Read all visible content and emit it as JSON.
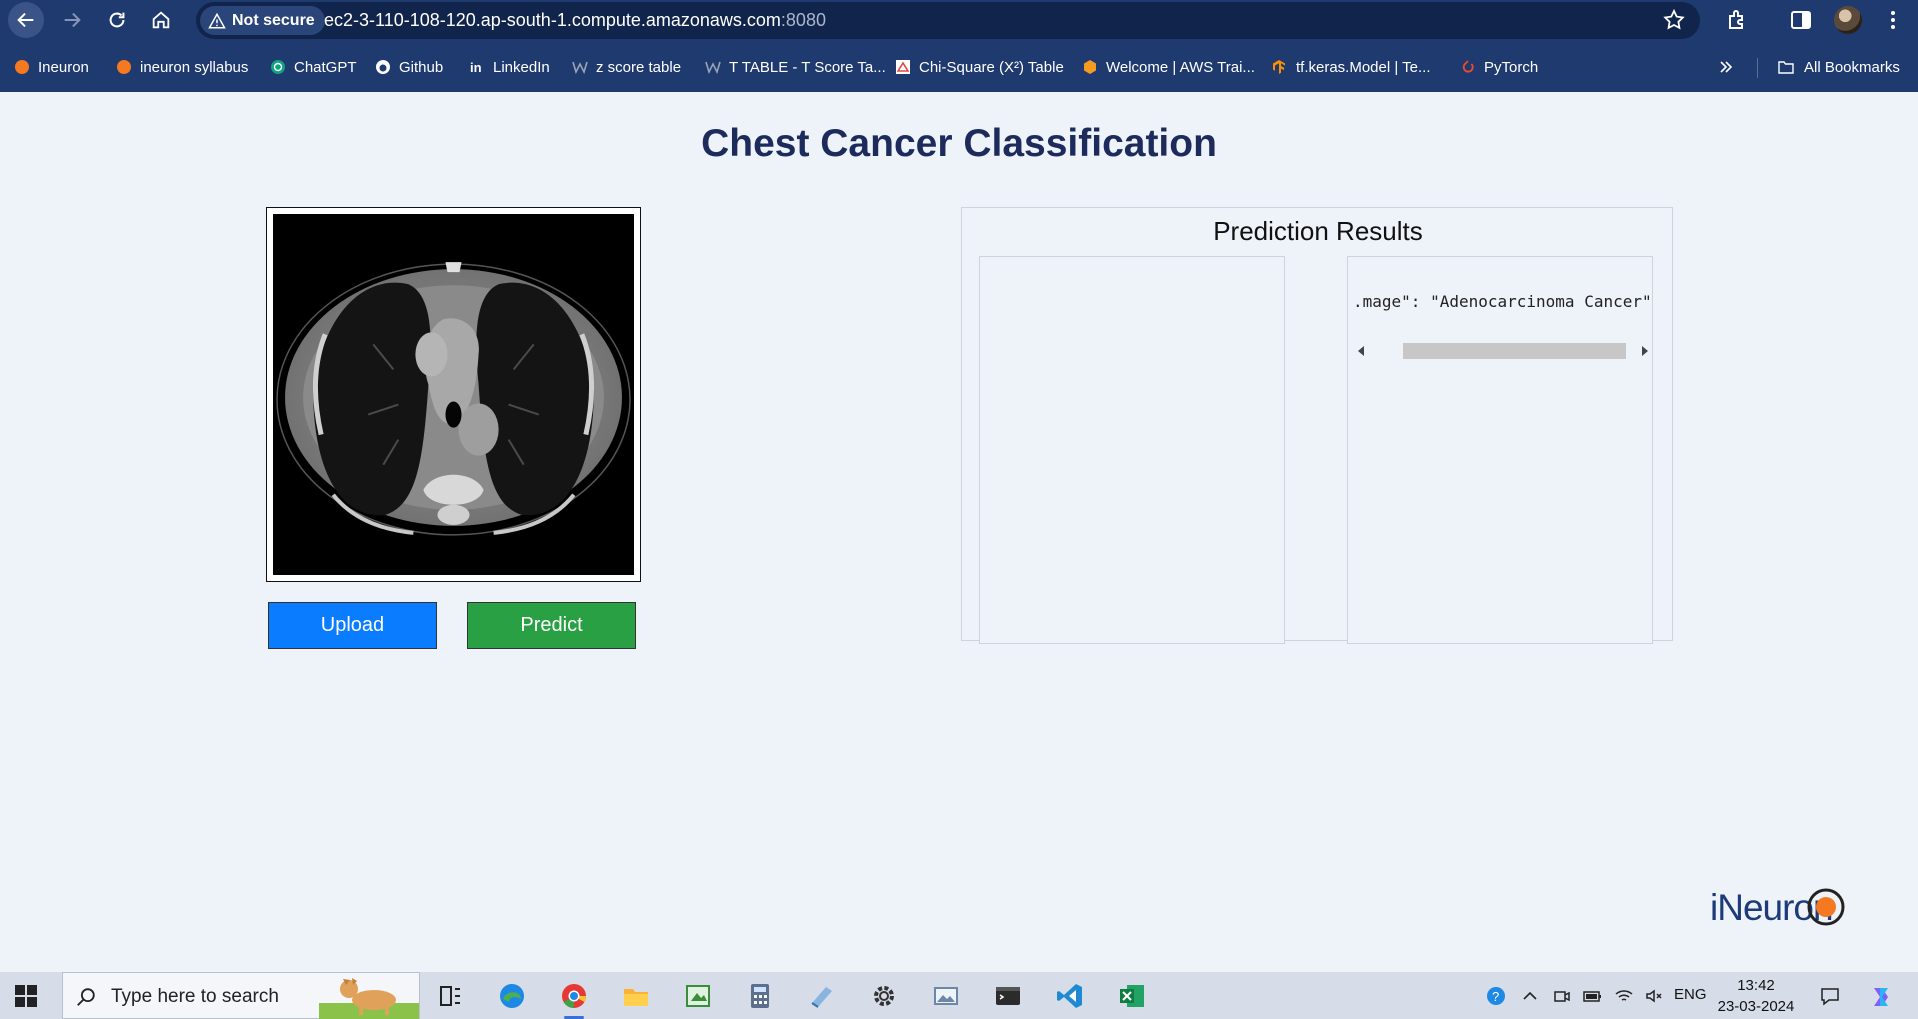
{
  "browser": {
    "security_label": "Not secure",
    "url_host": "ec2-3-110-108-120.ap-south-1.compute.amazonaws.com",
    "url_port": ":8080",
    "bookmarks": [
      {
        "label": "Ineuron",
        "icon": "ineuron-favicon",
        "color": "#f47920"
      },
      {
        "label": "ineuron syllabus",
        "icon": "ineuron-favicon",
        "color": "#f47920"
      },
      {
        "label": "ChatGPT",
        "icon": "chatgpt-favicon",
        "color": "#10a37f"
      },
      {
        "label": "Github",
        "icon": "github-favicon",
        "color": "#ffffff"
      },
      {
        "label": "LinkedIn",
        "icon": "linkedin-favicon",
        "color": "#ffffff"
      },
      {
        "label": "z score table",
        "icon": "w-favicon",
        "color": "#9aa4b8"
      },
      {
        "label": "T TABLE - T Score Ta...",
        "icon": "w-favicon",
        "color": "#9aa4b8"
      },
      {
        "label": "Chi-Square (X²) Table",
        "icon": "chi-favicon",
        "color": "#e04848"
      },
      {
        "label": "Welcome | AWS Trai...",
        "icon": "aws-favicon",
        "color": "#f59b1f"
      },
      {
        "label": "tf.keras.Model  |  Te...",
        "icon": "tensorflow-favicon",
        "color": "#ff8f00"
      },
      {
        "label": "PyTorch",
        "icon": "pytorch-favicon",
        "color": "#ee4c2c"
      }
    ],
    "all_bookmarks_label": "All Bookmarks"
  },
  "page": {
    "title": "Chest Cancer Classification",
    "upload_label": "Upload",
    "predict_label": "Predict",
    "results_title": "Prediction Results",
    "result_json_line": ".mage\": \"Adenocarcinoma Cancer\"",
    "logo_text": "iNeuron"
  },
  "taskbar": {
    "search_placeholder": "Type here to search",
    "language": "ENG",
    "time": "13:42",
    "date": "23-03-2024"
  },
  "colors": {
    "chrome": "#1f3a6f",
    "page_bg": "#eef2f9",
    "title": "#1d2b5c",
    "upload_button": "#0a7cff",
    "predict_button": "#28a043"
  }
}
